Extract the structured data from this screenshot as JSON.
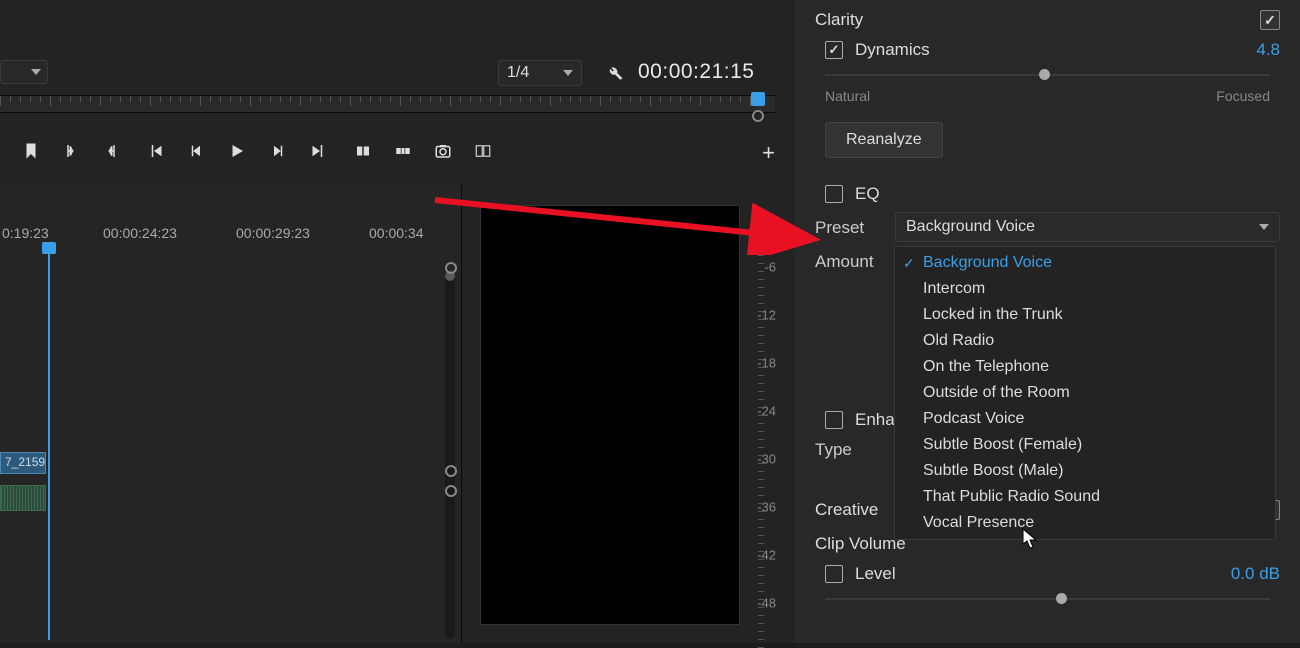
{
  "toolbar": {
    "zoom": "1/4",
    "timecode": "00:00:21:15"
  },
  "timeline": {
    "times": [
      "0:19:23",
      "00:00:24:23",
      "00:00:29:23",
      "00:00:34"
    ],
    "clip_name": "7_2159"
  },
  "db_scale": [
    "-6",
    "-12",
    "-18",
    "-24",
    "-30",
    "-36",
    "-42",
    "-48"
  ],
  "panel": {
    "clarity": {
      "title": "Clarity"
    },
    "dynamics": {
      "label": "Dynamics",
      "value": "4.8",
      "left": "Natural",
      "right": "Focused"
    },
    "reanalyze": "Reanalyze",
    "eq": {
      "label": "EQ"
    },
    "preset": {
      "label": "Preset",
      "value": "Background Voice"
    },
    "amount": {
      "label": "Amount"
    },
    "enhance": {
      "label": "Enhance"
    },
    "type": {
      "label": "Type"
    },
    "creative": {
      "title": "Creative"
    },
    "clipvolume": {
      "title": "Clip Volume"
    },
    "level": {
      "label": "Level",
      "value": "0.0 dB"
    }
  },
  "preset_options": [
    "Background Voice",
    "Intercom",
    "Locked in the Trunk",
    "Old Radio",
    "On the Telephone",
    "Outside of the Room",
    "Podcast Voice",
    "Subtle Boost (Female)",
    "Subtle Boost (Male)",
    "That Public Radio Sound",
    "Vocal Presence"
  ]
}
